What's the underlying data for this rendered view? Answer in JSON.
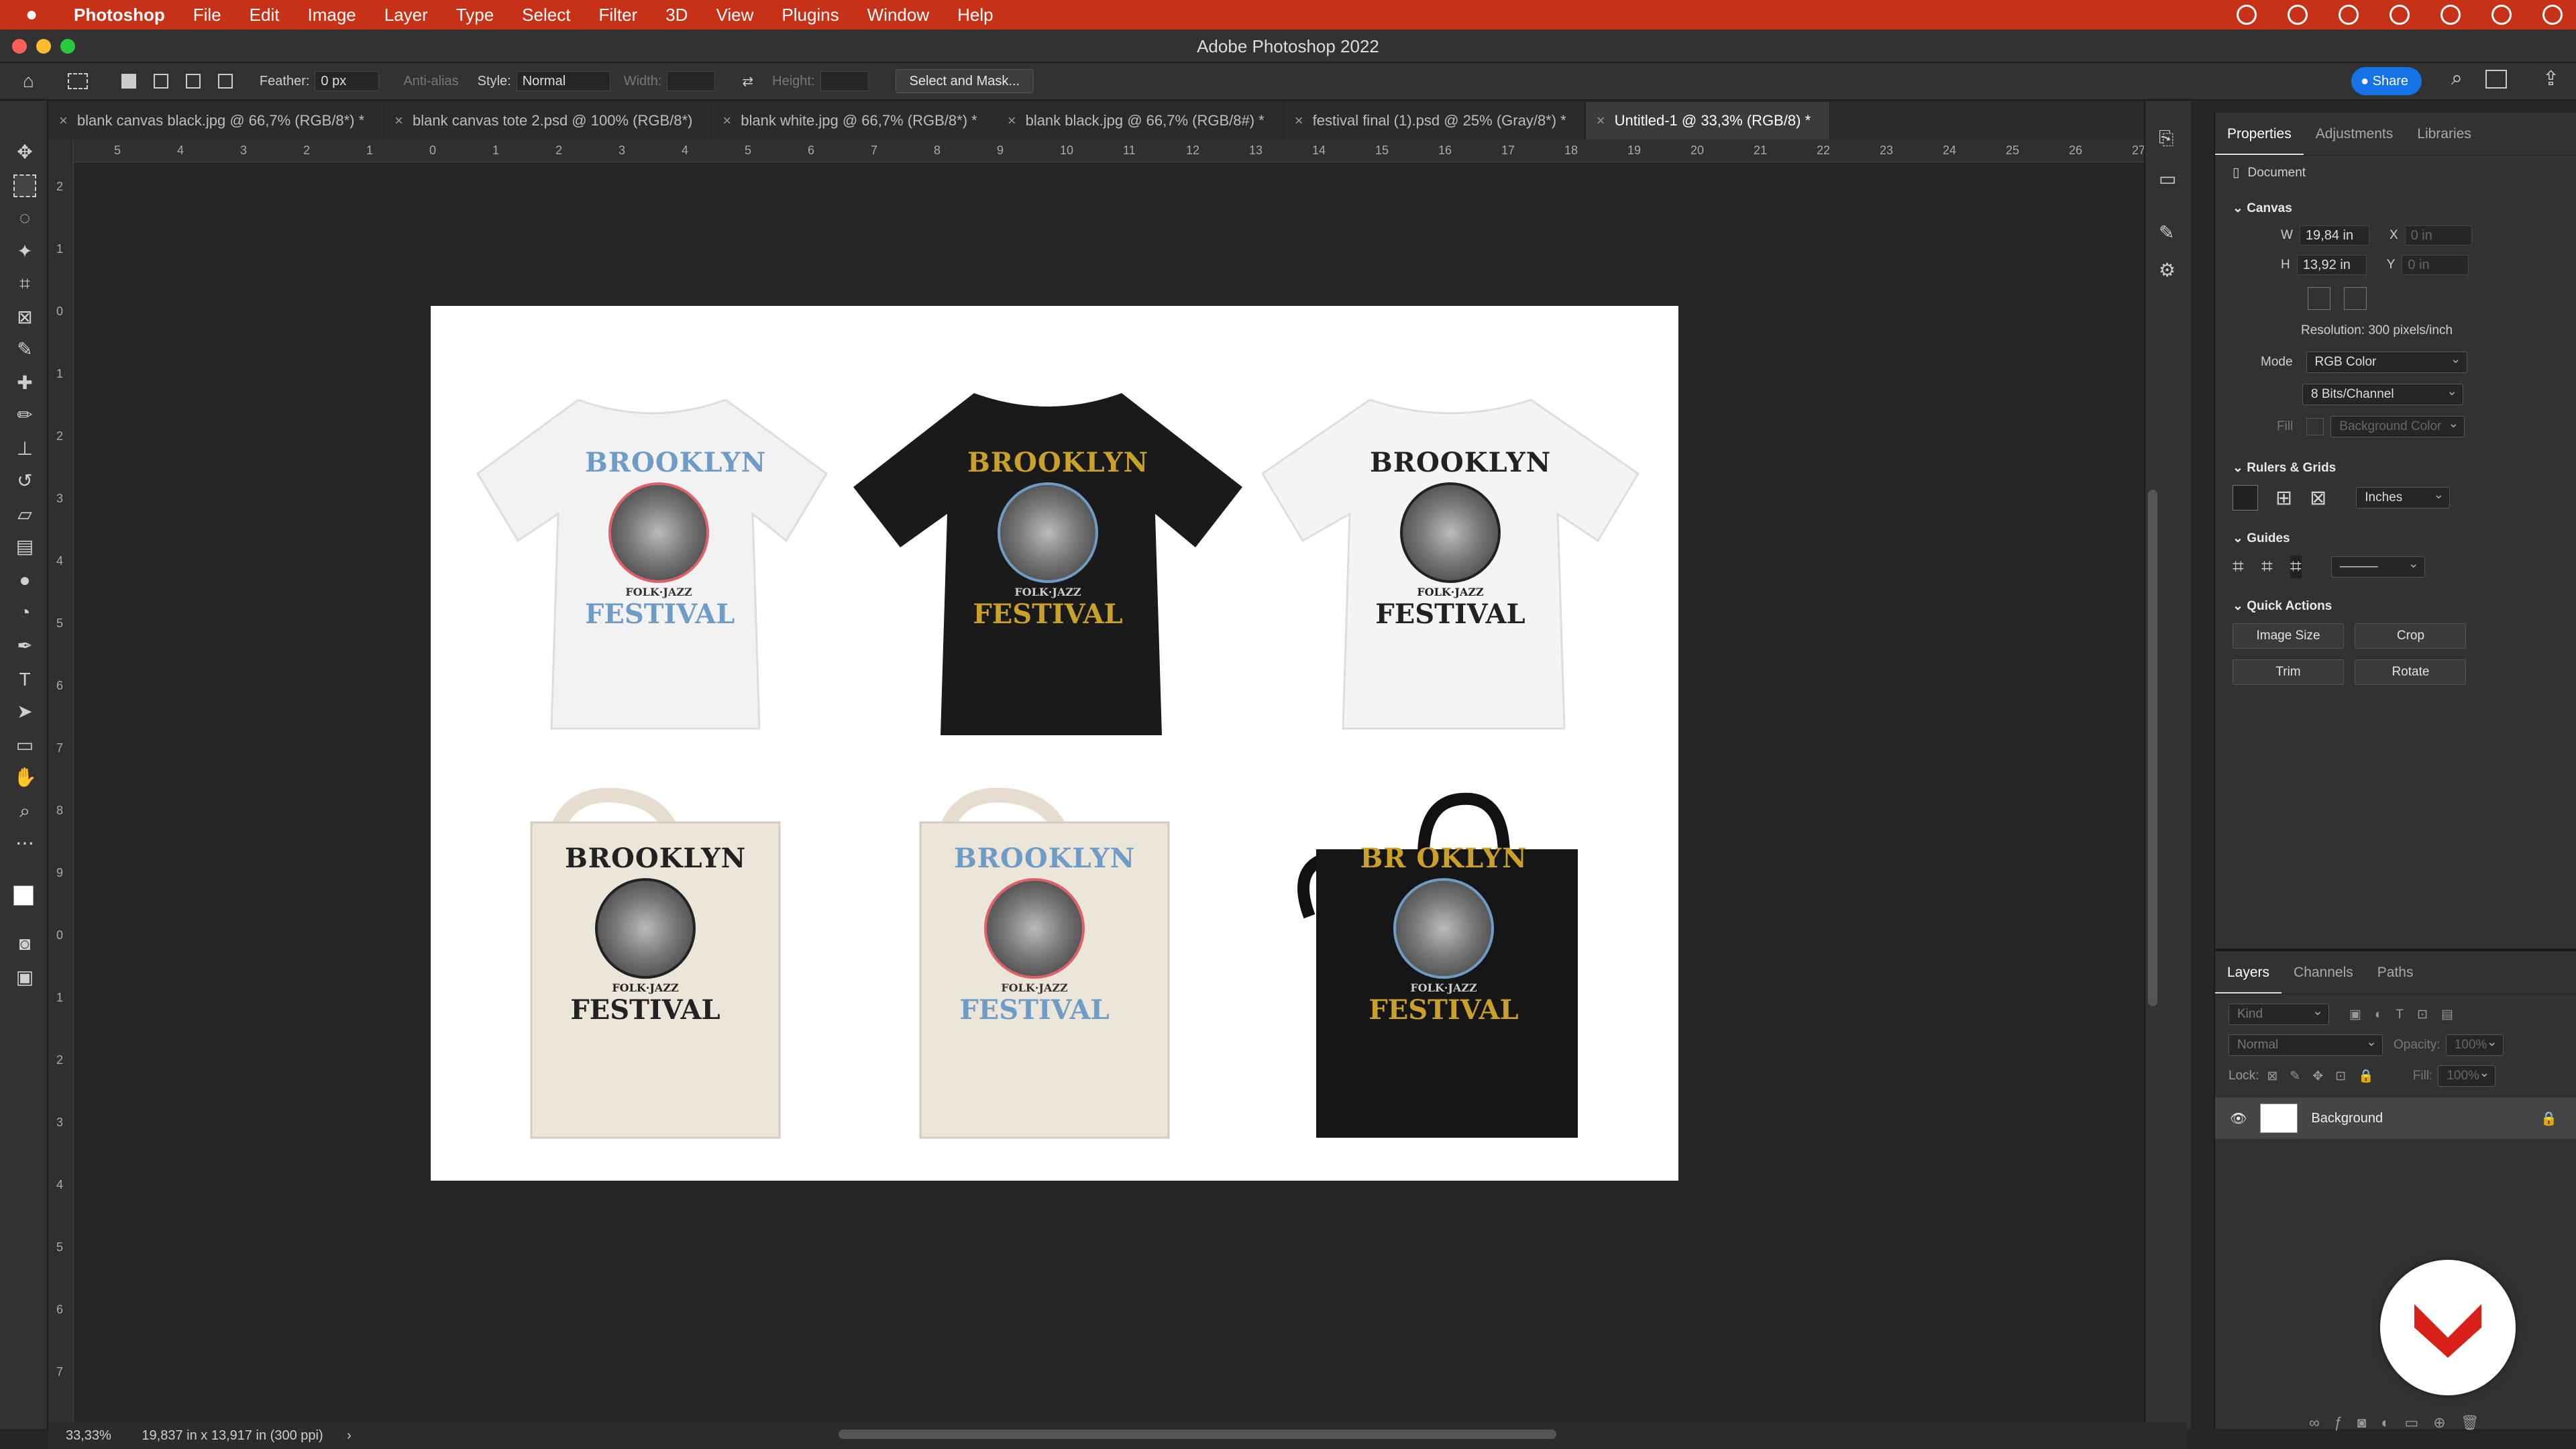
{
  "menu": {
    "app": "Photoshop",
    "items": [
      "File",
      "Edit",
      "Image",
      "Layer",
      "Type",
      "Select",
      "Filter",
      "3D",
      "View",
      "Plugins",
      "Window",
      "Help"
    ]
  },
  "window_title": "Adobe Photoshop 2022",
  "options": {
    "feather_label": "Feather:",
    "feather_value": "0 px",
    "antialias": "Anti-alias",
    "style_label": "Style:",
    "style_value": "Normal",
    "width_label": "Width:",
    "height_label": "Height:",
    "select_mask": "Select and Mask...",
    "share": "Share"
  },
  "tabs": [
    "blank canvas black.jpg @ 66,7% (RGB/8*) *",
    "blank canvas tote 2.psd @ 100% (RGB/8*)",
    "blank white.jpg @ 66,7% (RGB/8*) *",
    "blank black.jpg @ 66,7% (RGB/8#) *",
    "festival final (1).psd @ 25% (Gray/8*) *",
    "Untitled-1 @ 33,3% (RGB/8) *"
  ],
  "ruler_h": [
    "5",
    "4",
    "3",
    "2",
    "1",
    "0",
    "1",
    "2",
    "3",
    "4",
    "5",
    "6",
    "7",
    "8",
    "9",
    "10",
    "11",
    "12",
    "13",
    "14",
    "15",
    "16",
    "17",
    "18",
    "19",
    "20",
    "21",
    "22",
    "23",
    "24",
    "25",
    "26",
    "27"
  ],
  "ruler_v": [
    "2",
    "1",
    "0",
    "1",
    "2",
    "3",
    "4",
    "5",
    "6",
    "7",
    "8",
    "9",
    "0",
    "1",
    "2",
    "3",
    "4",
    "5",
    "6",
    "7"
  ],
  "design": {
    "title": "BROOKLYN",
    "sub": "FOLK·JAZZ",
    "festival": "FESTIVAL",
    "title_dark": "BR  OKLYN"
  },
  "properties": {
    "tabs": [
      "Properties",
      "Adjustments",
      "Libraries"
    ],
    "doc_label": "Document",
    "canvas": "Canvas",
    "w_label": "W",
    "w_value": "19,84 in",
    "x_label": "X",
    "x_value": "0 in",
    "h_label": "H",
    "h_value": "13,92 in",
    "y_label": "Y",
    "y_value": "0 in",
    "resolution": "Resolution: 300 pixels/inch",
    "mode_label": "Mode",
    "mode_value": "RGB Color",
    "bits_value": "8 Bits/Channel",
    "fill_label": "Fill",
    "fill_value": "Background Color",
    "rulers": "Rulers & Grids",
    "units": "Inches",
    "guides": "Guides",
    "quick": "Quick Actions",
    "qa": [
      "Image Size",
      "Crop",
      "Trim",
      "Rotate"
    ]
  },
  "layers": {
    "tabs": [
      "Layers",
      "Channels",
      "Paths"
    ],
    "kind": "Kind",
    "blend": "Normal",
    "opacity_label": "Opacity:",
    "opacity_value": "100%",
    "lock_label": "Lock:",
    "fill_label": "Fill:",
    "fill_value": "100%",
    "layer_name": "Background"
  },
  "status": {
    "zoom": "33,33%",
    "info": "19,837 in x 13,917 in (300 ppi)"
  },
  "colors": {
    "accent": "#c63118",
    "share": "#1473e6",
    "blue": "#6f9cc7",
    "gold": "#c9a02a"
  }
}
